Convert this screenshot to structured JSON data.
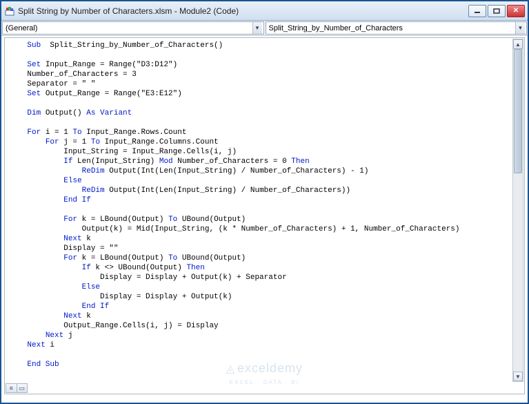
{
  "title": "Split String by Number of Characters.xlsm - Module2 (Code)",
  "dropdowns": {
    "left": "(General)",
    "right": "Split_String_by_Number_of_Characters"
  },
  "watermark": {
    "brand": "exceldemy",
    "sub": "EXCEL · DATA · BI"
  },
  "code_tokens": [
    [
      [
        "kw",
        "Sub"
      ],
      [
        "",
        "  Split_String_by_Number_of_Characters()"
      ]
    ],
    [
      [
        "",
        ""
      ]
    ],
    [
      [
        "kw",
        "Set"
      ],
      [
        "",
        " Input_Range = Range(\"D3:D12\")"
      ]
    ],
    [
      [
        "",
        "Number_of_Characters = 3"
      ]
    ],
    [
      [
        "",
        "Separator = \" \""
      ]
    ],
    [
      [
        "kw",
        "Set"
      ],
      [
        "",
        " Output_Range = Range(\"E3:E12\")"
      ]
    ],
    [
      [
        "",
        ""
      ]
    ],
    [
      [
        "kw",
        "Dim"
      ],
      [
        "",
        " Output() "
      ],
      [
        "kw",
        "As Variant"
      ]
    ],
    [
      [
        "",
        ""
      ]
    ],
    [
      [
        "kw",
        "For"
      ],
      [
        "",
        " i = 1 "
      ],
      [
        "kw",
        "To"
      ],
      [
        "",
        " Input_Range.Rows.Count"
      ]
    ],
    [
      [
        "",
        "    "
      ],
      [
        "kw",
        "For"
      ],
      [
        "",
        " j = 1 "
      ],
      [
        "kw",
        "To"
      ],
      [
        "",
        " Input_Range.Columns.Count"
      ]
    ],
    [
      [
        "",
        "        Input_String = Input_Range.Cells(i, j)"
      ]
    ],
    [
      [
        "",
        "        "
      ],
      [
        "kw",
        "If"
      ],
      [
        "",
        " Len(Input_String) "
      ],
      [
        "kw",
        "Mod"
      ],
      [
        "",
        " Number_of_Characters = 0 "
      ],
      [
        "kw",
        "Then"
      ]
    ],
    [
      [
        "",
        "            "
      ],
      [
        "kw",
        "ReDim"
      ],
      [
        "",
        " Output(Int(Len(Input_String) / Number_of_Characters) - 1)"
      ]
    ],
    [
      [
        "",
        "        "
      ],
      [
        "kw",
        "Else"
      ]
    ],
    [
      [
        "",
        "            "
      ],
      [
        "kw",
        "ReDim"
      ],
      [
        "",
        " Output(Int(Len(Input_String) / Number_of_Characters))"
      ]
    ],
    [
      [
        "",
        "        "
      ],
      [
        "kw",
        "End If"
      ]
    ],
    [
      [
        "",
        ""
      ]
    ],
    [
      [
        "",
        "        "
      ],
      [
        "kw",
        "For"
      ],
      [
        "",
        " k = LBound(Output) "
      ],
      [
        "kw",
        "To"
      ],
      [
        "",
        " UBound(Output)"
      ]
    ],
    [
      [
        "",
        "            Output(k) = Mid(Input_String, (k * Number_of_Characters) + 1, Number_of_Characters)"
      ]
    ],
    [
      [
        "",
        "        "
      ],
      [
        "kw",
        "Next"
      ],
      [
        "",
        " k"
      ]
    ],
    [
      [
        "",
        "        Display = \"\""
      ]
    ],
    [
      [
        "",
        "        "
      ],
      [
        "kw",
        "For"
      ],
      [
        "",
        " k = LBound(Output) "
      ],
      [
        "kw",
        "To"
      ],
      [
        "",
        " UBound(Output)"
      ]
    ],
    [
      [
        "",
        "            "
      ],
      [
        "kw",
        "If"
      ],
      [
        "",
        " k <> UBound(Output) "
      ],
      [
        "kw",
        "Then"
      ]
    ],
    [
      [
        "",
        "                Display = Display + Output(k) + Separator"
      ]
    ],
    [
      [
        "",
        "            "
      ],
      [
        "kw",
        "Else"
      ]
    ],
    [
      [
        "",
        "                Display = Display + Output(k)"
      ]
    ],
    [
      [
        "",
        "            "
      ],
      [
        "kw",
        "End If"
      ]
    ],
    [
      [
        "",
        "        "
      ],
      [
        "kw",
        "Next"
      ],
      [
        "",
        " k"
      ]
    ],
    [
      [
        "",
        "        Output_Range.Cells(i, j) = Display"
      ]
    ],
    [
      [
        "",
        "    "
      ],
      [
        "kw",
        "Next"
      ],
      [
        "",
        " j"
      ]
    ],
    [
      [
        "kw",
        "Next"
      ],
      [
        "",
        " i"
      ]
    ],
    [
      [
        "",
        ""
      ]
    ],
    [
      [
        "kw",
        "End Sub"
      ]
    ]
  ]
}
